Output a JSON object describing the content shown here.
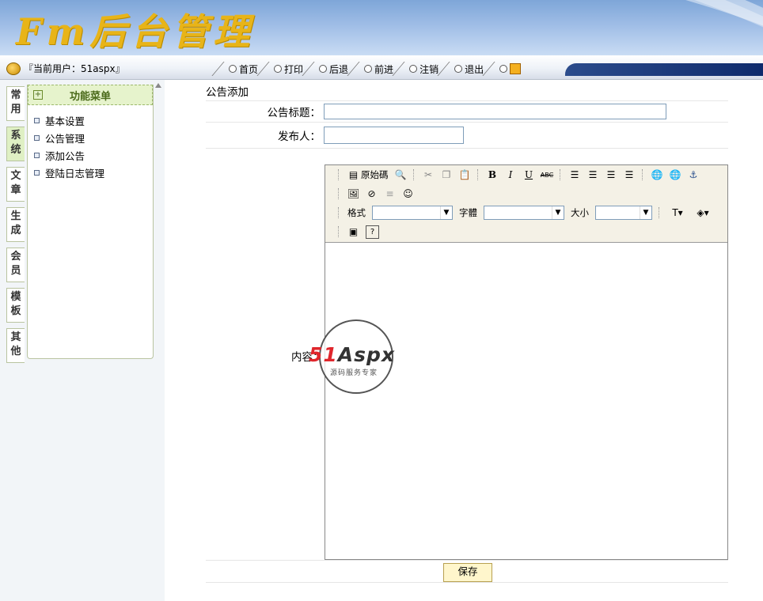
{
  "header": {
    "logo_text": "Fm后台管理"
  },
  "navbar": {
    "current_user": "『当前用户：51aspx』",
    "items": [
      "首页",
      "打印",
      "后退",
      "前进",
      "注销",
      "退出"
    ]
  },
  "sidebar": {
    "tabs": [
      {
        "label": "常用"
      },
      {
        "label": "系统"
      },
      {
        "label": "文章"
      },
      {
        "label": "生成"
      },
      {
        "label": "会员"
      },
      {
        "label": "模板"
      },
      {
        "label": "其他"
      }
    ],
    "menu_title": "功能菜单",
    "menu_items": [
      "基本设置",
      "公告管理",
      "添加公告",
      "登陆日志管理"
    ]
  },
  "form": {
    "page_title": "公告添加",
    "title_label": "公告标题：",
    "title_value": "",
    "author_label": "发布人：",
    "author_value": "",
    "content_label": "内容：",
    "save_label": "保存"
  },
  "editor": {
    "source_label": "原始碼",
    "format_label": "格式",
    "font_label": "字體",
    "size_label": "大小"
  },
  "watermark": {
    "brand_red": "51",
    "brand_rest": "Aspx",
    "subtitle": "源码服务专家"
  },
  "colors": {
    "logo_gold": "#e8b418",
    "header_blue": "#7ea6d8",
    "menu_green": "#e6f3cc",
    "save_bg": "#fff6cc"
  }
}
